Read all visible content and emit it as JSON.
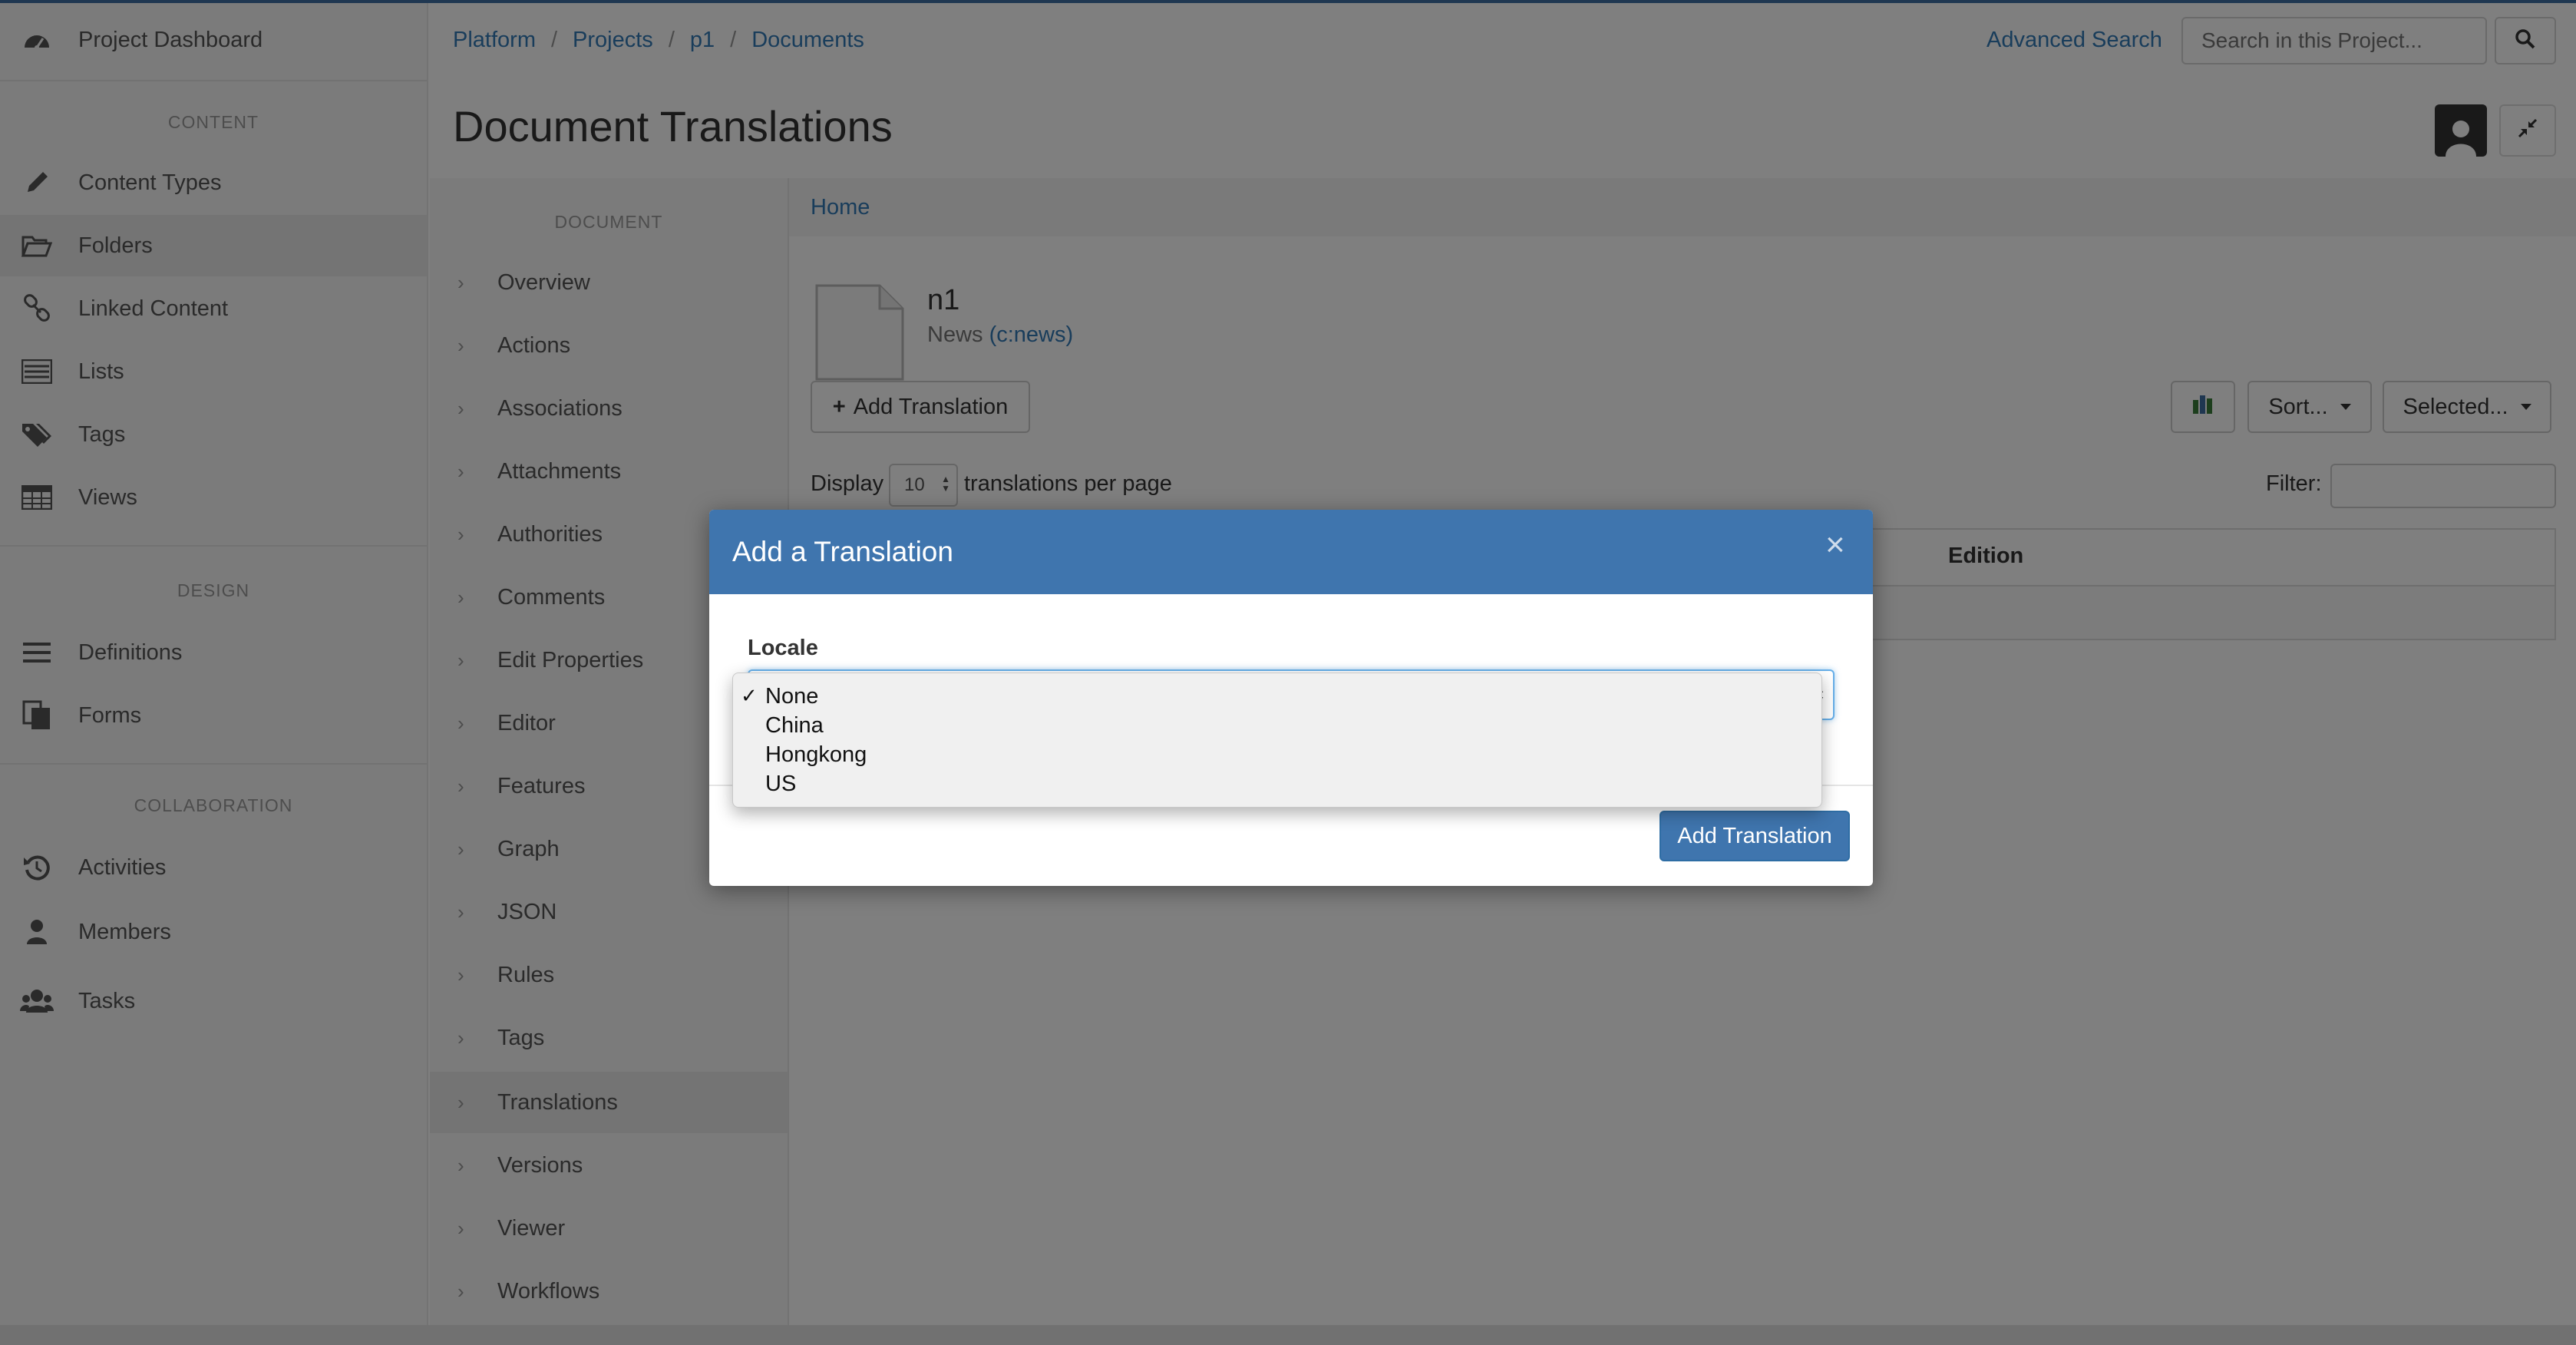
{
  "colors": {
    "accent": "#3f75ae",
    "link": "#337ab7"
  },
  "sidebar": {
    "dashboard": {
      "label": "Project Dashboard",
      "icon": "dashboard-icon"
    },
    "sections": [
      "CONTENT",
      "DESIGN",
      "COLLABORATION"
    ],
    "content_items": [
      {
        "label": "Content Types",
        "icon": "pencil-icon"
      },
      {
        "label": "Folders",
        "icon": "folder-icon",
        "active": true
      },
      {
        "label": "Linked Content",
        "icon": "link-icon"
      },
      {
        "label": "Lists",
        "icon": "list-icon"
      },
      {
        "label": "Tags",
        "icon": "tags-icon"
      },
      {
        "label": "Views",
        "icon": "table-icon"
      }
    ],
    "design_items": [
      {
        "label": "Definitions",
        "icon": "bars-icon"
      },
      {
        "label": "Forms",
        "icon": "forms-icon"
      }
    ],
    "collab_items": [
      {
        "label": "Activities",
        "icon": "history-icon"
      },
      {
        "label": "Members",
        "icon": "user-icon"
      },
      {
        "label": "Tasks",
        "icon": "users-icon"
      }
    ]
  },
  "header": {
    "breadcrumb": [
      "Platform",
      "Projects",
      "p1",
      "Documents"
    ],
    "advanced_search": "Advanced Search",
    "search_placeholder": "Search in this Project...",
    "title": "Document Translations"
  },
  "subnav": {
    "title": "DOCUMENT",
    "items": [
      "Overview",
      "Actions",
      "Associations",
      "Attachments",
      "Authorities",
      "Comments",
      "Edit Properties",
      "Editor",
      "Features",
      "Graph",
      "JSON",
      "Rules",
      "Tags",
      "Translations",
      "Versions",
      "Viewer",
      "Workflows"
    ],
    "active": "Translations"
  },
  "main": {
    "home_link": "Home",
    "doc_name": "n1",
    "doc_type_prefix": "News",
    "doc_type_link": "(c:news)",
    "add_translation_btn": "Add Translation",
    "sort_btn": "Sort...",
    "selected_btn": "Selected...",
    "display_label": "Display",
    "page_size": "10",
    "per_page_label": "translations per page",
    "filter_label": "Filter:",
    "table_column": "Edition"
  },
  "modal": {
    "title": "Add a Translation",
    "close": "×",
    "locale_label": "Locale",
    "options": [
      "None",
      "China",
      "Hongkong",
      "US"
    ],
    "selected": "None",
    "checkmark": "✓",
    "submit": "Add Translation"
  }
}
